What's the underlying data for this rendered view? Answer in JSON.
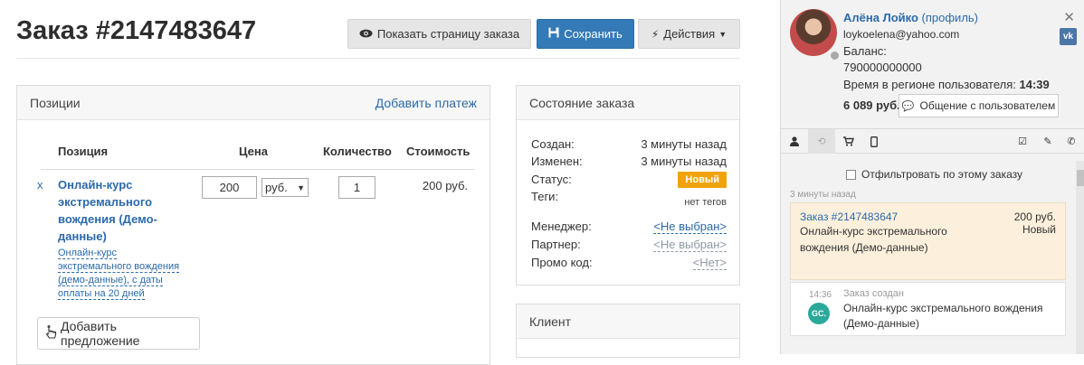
{
  "header": {
    "title": "Заказ #2147483647",
    "show_page_label": "Показать страницу заказа",
    "save_label": "Сохранить",
    "actions_label": "Действия"
  },
  "positions": {
    "title": "Позиции",
    "add_payment": "Добавить платеж",
    "columns": {
      "position": "Позиция",
      "price": "Цена",
      "quantity": "Количество",
      "cost": "Стоимость"
    },
    "remove": "x",
    "item": {
      "name": "Онлайн-курс экстремального вождения (Демо-данные)",
      "description": "Онлайн-курс экстремального вождения (демо-данные), с даты оплаты на 20 дней",
      "price": "200",
      "currency": "руб.",
      "quantity": "1",
      "cost": "200 руб."
    },
    "add_offer": "Добавить предложение"
  },
  "state": {
    "title": "Состояние заказа",
    "created_label": "Создан:",
    "created_value": "3 минуты назад",
    "changed_label": "Изменен:",
    "changed_value": "3 минуты назад",
    "status_label": "Статус:",
    "status_value": "Новый",
    "tags_label": "Теги:",
    "tags_value": "нет тегов",
    "manager_label": "Менеджер:",
    "manager_value": "<Не выбран>",
    "partner_label": "Партнер:",
    "partner_value": "<Не выбран>",
    "promo_label": "Промо код:",
    "promo_value": "<Нет>",
    "status_color": "#f0a30a"
  },
  "client": {
    "title": "Клиент"
  },
  "sidebar": {
    "user_name": "Алёна Лойко",
    "profile_link": "(профиль)",
    "email": "loykoelena@yahoo.com",
    "balance_label": "Баланс:",
    "phone": "790000000000",
    "region_time_label": "Время в регионе пользователя:",
    "region_time": "14:39",
    "amount": "6 089 руб.",
    "chat_button": "Общение с пользователем",
    "vk_badge": "vk",
    "filter_label": "Отфильтровать по этому заказу",
    "ago": "3 минуты назад",
    "order_card": {
      "title": "Заказ #2147483647",
      "amount": "200 руб.",
      "text": "Онлайн-курс экстремального вождения (Демо-данные)",
      "status": "Новый"
    },
    "event": {
      "time": "14:36",
      "label": "Заказ создан",
      "logo": "GC.",
      "text": "Онлайн-курс экстремального вождения (Демо-данные)"
    }
  }
}
